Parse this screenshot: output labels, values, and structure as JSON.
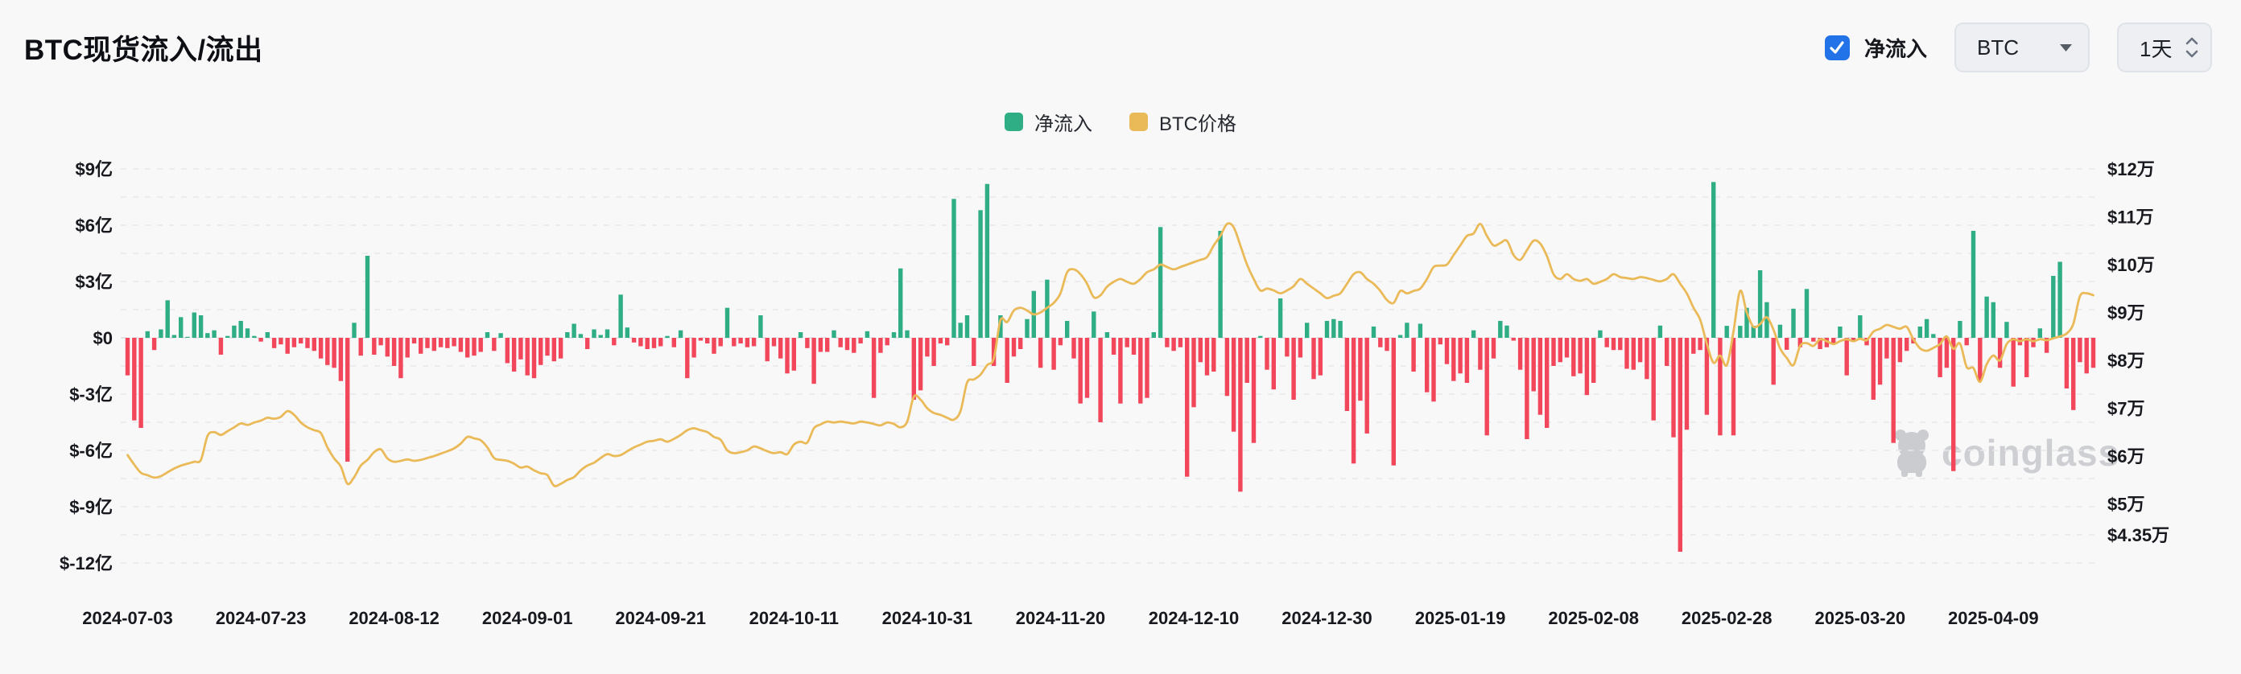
{
  "header": {
    "title": "BTC现货流入/流出",
    "net_inflow_checkbox": {
      "label": "净流入",
      "checked": true,
      "color": "#2273E8"
    },
    "coin_select": {
      "value": "BTC"
    },
    "interval_select": {
      "value": "1天"
    }
  },
  "legend": {
    "items": [
      {
        "label": "净流入",
        "color": "#2FAE85"
      },
      {
        "label": "BTC价格",
        "color": "#EABA58"
      }
    ]
  },
  "watermark": {
    "text": "coinglass"
  },
  "chart_data": {
    "type": "bar+line",
    "title": "BTC现货流入/流出",
    "x_start_date": "2024-07-03",
    "x_interval_days": 1,
    "x_tick_every_n_days": 20,
    "x_tick_labels": [
      "2024-07-03",
      "2024-07-23",
      "2024-08-12",
      "2024-09-01",
      "2024-09-21",
      "2024-10-11",
      "2024-10-31",
      "2024-11-20",
      "2024-12-10",
      "2024-12-30",
      "2025-01-19",
      "2025-02-08",
      "2025-02-28",
      "2025-03-20",
      "2025-04-09"
    ],
    "left_axis": {
      "unit": "亿美元",
      "labels": [
        "$9亿",
        "$6亿",
        "$3亿",
        "$0",
        "$-3亿",
        "$-6亿",
        "$-9亿",
        "$-12亿"
      ],
      "values": [
        9,
        6,
        3,
        0,
        -3,
        -6,
        -9,
        -12
      ],
      "minor_grid_step": 1.5,
      "grid": true
    },
    "right_axis": {
      "unit": "万美元",
      "labels": [
        "$12万",
        "$11万",
        "$10万",
        "$9万",
        "$8万",
        "$7万",
        "$6万",
        "$5万",
        "$4.35万"
      ],
      "values": [
        12,
        11,
        10,
        9,
        8,
        7,
        6,
        5,
        4.35
      ]
    },
    "series": [
      {
        "name": "净流入",
        "type": "bar",
        "unit": "亿美元",
        "positive_color": "#2FAE85",
        "negative_color": "#F2465A",
        "values": [
          -2,
          -4.4,
          -4.8,
          0.35,
          -0.65,
          0.45,
          2,
          0.15,
          1.1,
          0.05,
          1.35,
          1.2,
          0.25,
          0.4,
          -0.9,
          0.1,
          0.65,
          0.9,
          0.5,
          0.1,
          -0.2,
          0.3,
          -0.55,
          -0.35,
          -0.85,
          -0.5,
          -0.3,
          -0.55,
          -0.7,
          -1.1,
          -1.45,
          -1.6,
          -2.3,
          -6.6,
          0.8,
          -0.95,
          4.37,
          -0.9,
          -0.4,
          -1,
          -1.5,
          -2.15,
          -1.05,
          -0.3,
          -0.85,
          -0.55,
          -0.7,
          -0.5,
          -0.55,
          -0.45,
          -0.75,
          -1.05,
          -0.95,
          -0.75,
          0.3,
          -0.7,
          0.25,
          -1.35,
          -1.8,
          -1.15,
          -2,
          -2.15,
          -1.45,
          -0.95,
          -1.25,
          -1.1,
          0.3,
          0.75,
          0.2,
          -0.6,
          0.45,
          0.15,
          0.45,
          -0.4,
          2.3,
          0.55,
          -0.25,
          -0.45,
          -0.6,
          -0.55,
          -0.45,
          0.1,
          -0.5,
          0.4,
          -2.15,
          -1.05,
          -0.15,
          -0.3,
          -0.85,
          -0.45,
          1.6,
          -0.45,
          -0.3,
          -0.5,
          -0.45,
          1.2,
          -1.25,
          -0.45,
          -1.1,
          -1.9,
          -1.75,
          0.3,
          -0.55,
          -2.45,
          -0.75,
          -0.75,
          0.4,
          -0.5,
          -0.65,
          -0.8,
          -0.3,
          0.35,
          -3.2,
          -0.8,
          -0.4,
          0.3,
          3.7,
          0.4,
          -3.3,
          -2.8,
          -1,
          -1.5,
          -0.3,
          -0.4,
          7.4,
          0.8,
          1.2,
          -1.5,
          6.8,
          8.2,
          -1.5,
          1.2,
          -2.4,
          -1,
          -0.6,
          1,
          2.5,
          -1.6,
          3.1,
          -1.7,
          -0.4,
          0.9,
          -1.1,
          -3.5,
          -3.2,
          1.4,
          -4.5,
          0.3,
          -0.9,
          -3.5,
          -0.5,
          -0.9,
          -3.5,
          -3.2,
          0.3,
          5.9,
          -0.5,
          -0.7,
          -0.5,
          -7.4,
          -3.7,
          -1.3,
          -2,
          -1.8,
          5.7,
          -3.1,
          -5,
          -8.2,
          -2.4,
          -5.6,
          0.1,
          -1.7,
          -2.75,
          2.1,
          -1,
          -3.3,
          -1.05,
          0.8,
          -2.2,
          -2,
          0.9,
          1,
          0.9,
          -3.9,
          -6.7,
          -3.35,
          -5.1,
          0.6,
          -0.5,
          -0.7,
          -6.8,
          0.15,
          0.8,
          -1.8,
          0.75,
          -2.9,
          -3.4,
          -0.35,
          -1.4,
          -2.3,
          -1.9,
          -2.4,
          0.4,
          -1.7,
          -5.2,
          -1.1,
          0.9,
          0.65,
          -0.15,
          -1.7,
          -5.4,
          -2.85,
          -4.1,
          -4.8,
          -1.5,
          -1.3,
          -1.05,
          -2.05,
          -1.9,
          -3.05,
          -2.4,
          0.4,
          -0.5,
          -0.65,
          -0.65,
          -1.65,
          -1.7,
          -1.3,
          -2.2,
          -4.4,
          0.65,
          -1.5,
          -5.3,
          -11.4,
          -4.9,
          -0.85,
          -0.65,
          -4.1,
          8.3,
          -5.2,
          0.64,
          -5.2,
          0.64,
          1.6,
          0.64,
          3.6,
          1.9,
          -2.5,
          0.7,
          -0.64,
          1.55,
          -0.5,
          2.6,
          -0.2,
          -0.6,
          -0.5,
          -0.3,
          0.6,
          -2,
          -0.15,
          1.2,
          -0.4,
          -3.3,
          -2.5,
          -1.1,
          -5.6,
          -1.3,
          -0.7,
          -0.3,
          0.6,
          1,
          0.2,
          -2.1,
          -1.6,
          -7.1,
          0.9,
          -0.4,
          5.7,
          -2.3,
          2.2,
          1.9,
          -1.6,
          0.85,
          -2.6,
          -0.4,
          -2.1,
          -0.5,
          0.5,
          -0.8,
          3.3,
          4.05,
          -2.7,
          -3.85,
          -1.3,
          -1.9,
          -1.6
        ]
      },
      {
        "name": "BTC价格",
        "type": "line",
        "unit": "万美元",
        "color": "#EABA58",
        "values": [
          6.02,
          5.82,
          5.65,
          5.6,
          5.55,
          5.58,
          5.66,
          5.74,
          5.8,
          5.84,
          5.88,
          5.92,
          6.42,
          6.5,
          6.44,
          6.52,
          6.6,
          6.68,
          6.65,
          6.7,
          6.74,
          6.8,
          6.78,
          6.82,
          6.94,
          6.86,
          6.7,
          6.6,
          6.54,
          6.48,
          6.18,
          5.95,
          5.78,
          5.42,
          5.56,
          5.8,
          5.92,
          6.08,
          6.14,
          5.95,
          5.88,
          5.9,
          5.93,
          5.9,
          5.92,
          5.96,
          6,
          6.05,
          6.1,
          6.16,
          6.26,
          6.4,
          6.37,
          6.33,
          6.18,
          5.96,
          5.92,
          5.9,
          5.84,
          5.76,
          5.78,
          5.7,
          5.64,
          5.6,
          5.38,
          5.42,
          5.5,
          5.56,
          5.7,
          5.8,
          5.86,
          5.96,
          6.04,
          6,
          6.02,
          6.1,
          6.18,
          6.24,
          6.3,
          6.32,
          6.35,
          6.3,
          6.36,
          6.44,
          6.54,
          6.58,
          6.54,
          6.5,
          6.4,
          6.34,
          6.12,
          6.06,
          6.08,
          6.12,
          6.2,
          6.16,
          6.1,
          6.06,
          6.08,
          6.04,
          6.24,
          6.3,
          6.28,
          6.58,
          6.66,
          6.72,
          6.7,
          6.72,
          6.7,
          6.68,
          6.72,
          6.7,
          6.67,
          6.64,
          6.7,
          6.67,
          6.6,
          6.72,
          7.24,
          7.18,
          7,
          6.9,
          6.86,
          6.8,
          6.76,
          6.94,
          7.54,
          7.6,
          7.7,
          7.9,
          8.04,
          8.84,
          8.8,
          9.04,
          9.1,
          9.04,
          8.96,
          9,
          9.1,
          9.2,
          9.4,
          9.84,
          9.9,
          9.8,
          9.6,
          9.32,
          9.36,
          9.54,
          9.64,
          9.7,
          9.64,
          9.6,
          9.7,
          9.84,
          9.9,
          10,
          9.95,
          9.9,
          9.95,
          10,
          10.05,
          10.1,
          10.16,
          10.4,
          10.6,
          10.85,
          10.78,
          10.4,
          10,
          9.7,
          9.46,
          9.5,
          9.46,
          9.4,
          9.46,
          9.55,
          9.7,
          9.6,
          9.5,
          9.4,
          9.3,
          9.35,
          9.4,
          9.6,
          9.8,
          9.84,
          9.7,
          9.6,
          9.45,
          9.26,
          9.2,
          9.45,
          9.4,
          9.45,
          9.5,
          9.7,
          9.95,
          9.98,
          10,
          10.2,
          10.4,
          10.6,
          10.65,
          10.85,
          10.6,
          10.4,
          10.45,
          10.5,
          10.2,
          10.1,
          10.3,
          10.5,
          10.44,
          10.18,
          9.8,
          9.7,
          9.8,
          9.7,
          9.66,
          9.7,
          9.6,
          9.64,
          9.7,
          9.8,
          9.74,
          9.72,
          9.7,
          9.74,
          9.72,
          9.68,
          9.65,
          9.7,
          9.8,
          9.6,
          9.4,
          9.1,
          8.85,
          8.35,
          7.95,
          8.1,
          7.9,
          8.6,
          9.45,
          9,
          8.7,
          8.76,
          8.9,
          8.64,
          8.25,
          8.05,
          7.9,
          8.3,
          8.36,
          8.3,
          8.44,
          8.4,
          8.34,
          8.4,
          8.44,
          8.4,
          8.45,
          8.42,
          8.6,
          8.66,
          8.74,
          8.7,
          8.66,
          8.7,
          8.44,
          8.25,
          8.2,
          8.26,
          8.34,
          8.5,
          8.24,
          8.35,
          7.86,
          7.84,
          7.55,
          7.92,
          8.1,
          8,
          8.34,
          8.44,
          8.4,
          8.44,
          8.4,
          8.44,
          8.42,
          8.46,
          8.5,
          8.56,
          8.76,
          9.34,
          9.4,
          9.36
        ]
      }
    ]
  }
}
